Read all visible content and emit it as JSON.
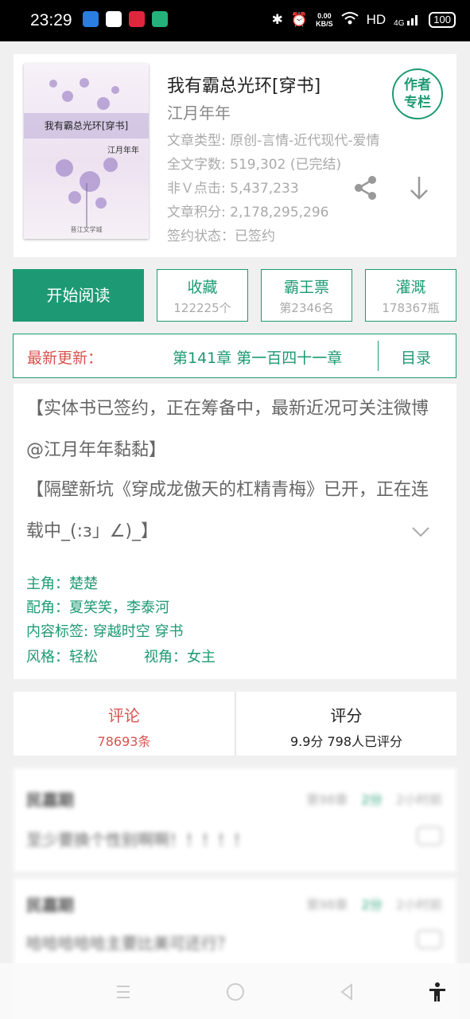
{
  "status_bar": {
    "time": "23:29",
    "speed_value": "0.00",
    "speed_unit": "KB/S",
    "network": "HD",
    "signal": "4G",
    "battery": "100"
  },
  "book": {
    "title": "我有霸总光环[穿书]",
    "author": "江月年年",
    "cover_title": "我有霸总光环[穿书]",
    "cover_author": "江月年年",
    "cover_publisher": "晋江文学城",
    "meta": [
      "文章类型: 原创-言情-近代现代-爱情",
      "全文字数: 519,302 (已完结)",
      "非Ｖ点击: 5,437,233",
      "文章积分: 2,178,295,296",
      "签约状态：已签约"
    ],
    "author_column_line1": "作者",
    "author_column_line2": "专栏"
  },
  "actions": {
    "read_label": "开始阅读",
    "collect_label": "收藏",
    "collect_count": "122225个",
    "ticket_label": "霸王票",
    "ticket_rank": "第2346名",
    "water_label": "灌溉",
    "water_count": "178367瓶"
  },
  "update": {
    "label": "最新更新：",
    "chapter": "第141章  第一百四十一章",
    "toc_label": "目录"
  },
  "description": {
    "para1": "【实体书已签约，正在筹备中，最新近况可关注微博@江月年年黏黏】",
    "para2": "【隔壁新坑《穿成龙傲天的杠精青梅》已开，正在连载中_(:з」∠)_】",
    "protagonist": "主角：楚楚",
    "supporting": "配角：夏笑笑，李泰河",
    "tags": "内容标签: 穿越时空 穿书",
    "style": "风格：轻松",
    "view": "视角：女主"
  },
  "tabs": {
    "comments_label": "评论",
    "comments_count": "78693条",
    "rating_label": "评分",
    "rating_value": "9.9分 798人已评分"
  },
  "comments": [
    {
      "name": "民嘉期",
      "chapter": "第98章",
      "score": "2分",
      "time": "2小时前",
      "text": "至少要换个性别啊啊！！！！！"
    },
    {
      "name": "民嘉期",
      "chapter": "第98章",
      "score": "2分",
      "time": "2小时前",
      "text": "哈哈哈哈哈主要比美可还行？"
    }
  ],
  "colors": {
    "accent": "#1d9a73",
    "highlight": "#d9534f"
  }
}
